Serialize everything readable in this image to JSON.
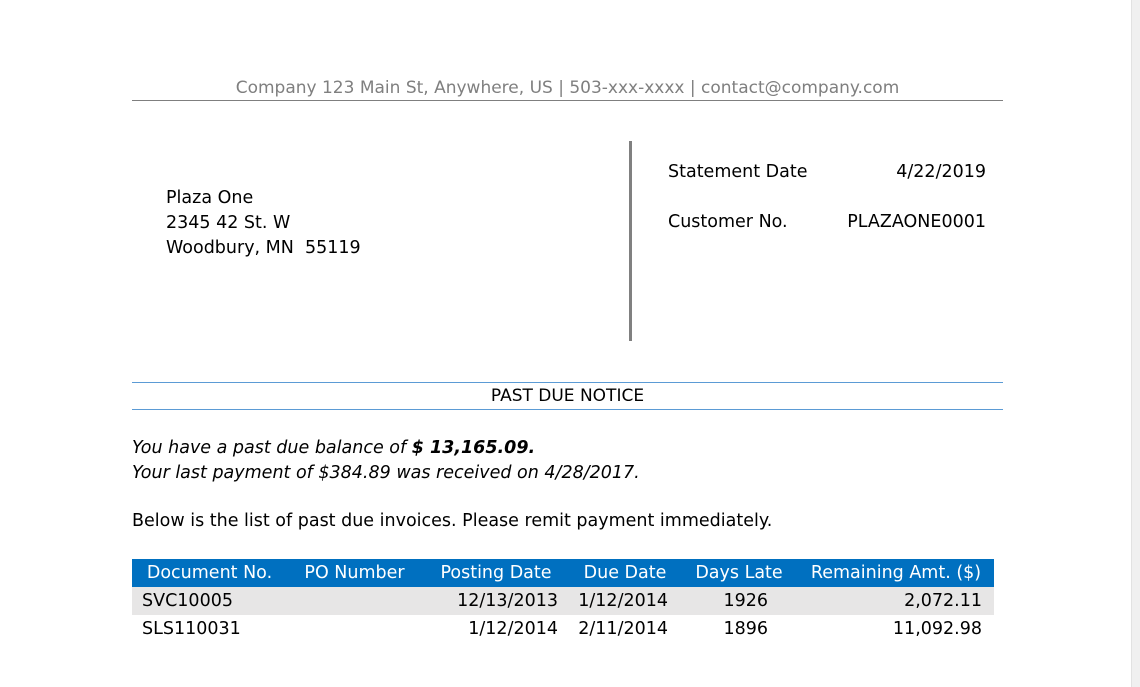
{
  "header": {
    "company_line": "Company 123 Main St, Anywhere, US | 503-xxx-xxxx | contact@company.com"
  },
  "customer_address": {
    "line1": "Plaza One",
    "line2": "2345 42 St. W",
    "line3": "Woodbury, MN  55119"
  },
  "statement": {
    "date_label": "Statement Date",
    "date_value": "4/22/2019",
    "customer_label": "Customer No.",
    "customer_value": "PLAZAONE0001"
  },
  "notice": {
    "title": "PAST DUE NOTICE",
    "balance_prefix": "You have a past due balance of ",
    "balance_amount": "$ 13,165.09.",
    "last_payment": "Your last payment of $384.89 was received on 4/28/2017.",
    "remit_text": "Below is the list of past due invoices. Please remit payment immediately."
  },
  "table": {
    "headers": [
      "Document No.",
      "PO Number",
      "Posting Date",
      "Due Date",
      "Days Late",
      "Remaining Amt. ($)"
    ],
    "rows": [
      {
        "doc": "SVC10005",
        "po": "",
        "posting": "12/13/2013",
        "due": "1/12/2014",
        "days": "1926",
        "amount": "2,072.11"
      },
      {
        "doc": "SLS110031",
        "po": "",
        "posting": "1/12/2014",
        "due": "2/11/2014",
        "days": "1896",
        "amount": "11,092.98"
      }
    ]
  }
}
